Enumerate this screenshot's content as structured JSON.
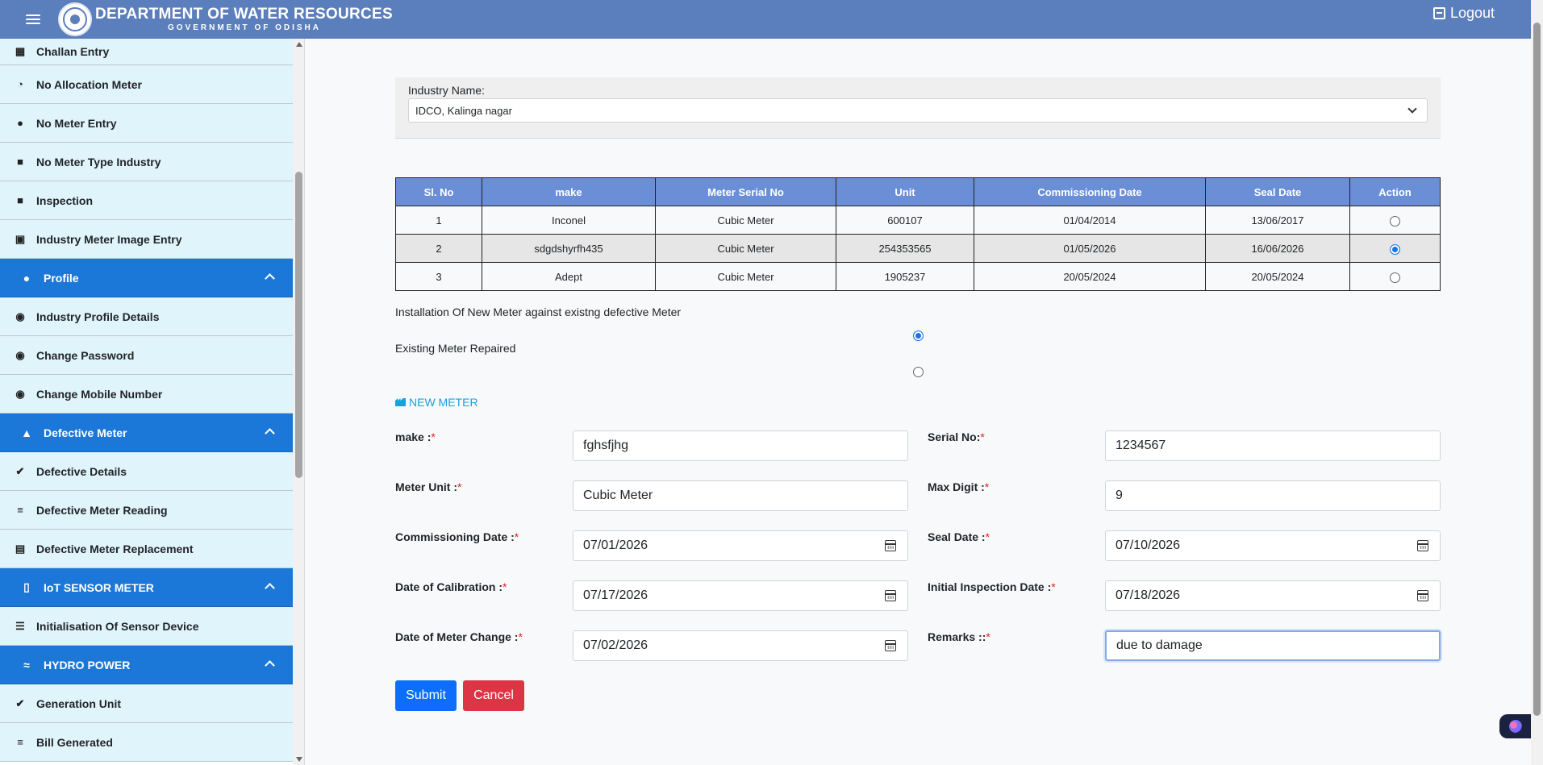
{
  "header": {
    "title": "DEPARTMENT OF WATER RESOURCES",
    "subtitle": "GOVERNMENT OF ODISHA",
    "logout": "Logout"
  },
  "sidebar": {
    "items_top": [
      {
        "label": "Challan Entry",
        "icon": "file-icon"
      },
      {
        "label": "No Allocation Meter",
        "icon": "gauge-icon"
      },
      {
        "label": "No Meter Entry",
        "icon": "alert-icon"
      },
      {
        "label": "No Meter Type Industry",
        "icon": "briefcase-icon"
      },
      {
        "label": "Inspection",
        "icon": "briefcase-icon"
      },
      {
        "label": "Industry Meter Image Entry",
        "icon": "image-icon"
      }
    ],
    "profile": {
      "label": "Profile",
      "items": [
        "Industry Profile Details",
        "Change Password",
        "Change Mobile Number"
      ]
    },
    "defective": {
      "label": "Defective Meter",
      "items": [
        "Defective Details",
        "Defective Meter Reading",
        "Defective Meter Replacement"
      ]
    },
    "iot": {
      "label": "IoT SENSOR METER",
      "items": [
        "Initialisation Of Sensor Device"
      ]
    },
    "hydro": {
      "label": "HYDRO POWER",
      "items": [
        "Generation Unit",
        "Bill Generated"
      ]
    }
  },
  "industry": {
    "label": "Industry Name:",
    "selected": "IDCO, Kalinga nagar"
  },
  "table": {
    "headers": [
      "Sl. No",
      "make",
      "Meter Serial No",
      "Unit",
      "Commissioning Date",
      "Seal Date",
      "Action"
    ],
    "rows": [
      {
        "sl": "1",
        "make": "Inconel",
        "serial": "Cubic Meter",
        "unit": "600107",
        "commissioning": "01/04/2014",
        "seal": "13/06/2017",
        "selected": false
      },
      {
        "sl": "2",
        "make": "sdgdshyrfh435",
        "serial": "Cubic Meter",
        "unit": "254353565",
        "commissioning": "01/05/2026",
        "seal": "16/06/2026",
        "selected": true
      },
      {
        "sl": "3",
        "make": "Adept",
        "serial": "Cubic Meter",
        "unit": "1905237",
        "commissioning": "20/05/2024",
        "seal": "20/05/2024",
        "selected": false
      }
    ]
  },
  "options": {
    "install_new": "Installation Of New Meter against existng defective Meter",
    "repaired": "Existing Meter Repaired"
  },
  "form": {
    "section_title": "NEW METER",
    "make_label": "make :",
    "make_value": "fghsfjhg",
    "serial_label": "Serial No:",
    "serial_value": "1234567",
    "unit_label": "Meter Unit :",
    "unit_value": "Cubic Meter",
    "maxdigit_label": "Max Digit :",
    "maxdigit_value": "9",
    "commissioning_label": "Commissioning Date :",
    "commissioning_value": "07/01/2026",
    "seal_label": "Seal Date :",
    "seal_value": "07/10/2026",
    "calibration_label": "Date of Calibration :",
    "calibration_value": "07/17/2026",
    "inspection_label": "Initial Inspection Date :",
    "inspection_value": "07/18/2026",
    "change_label": "Date of Meter Change :",
    "change_value": "07/02/2026",
    "remarks_label": "Remarks ::",
    "remarks_value": "due to damage",
    "required_mark": "*",
    "submit": "Submit",
    "cancel": "Cancel"
  }
}
